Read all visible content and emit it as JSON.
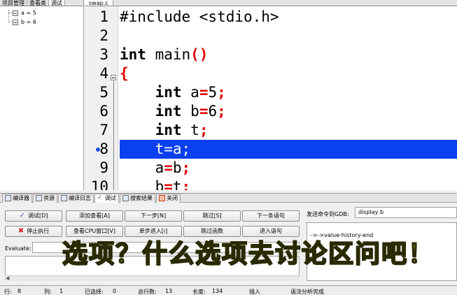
{
  "left_panel": {
    "tabs": [
      "项目管理",
      "查看类",
      "调试"
    ],
    "watches": [
      "a = 5",
      "b = 6"
    ]
  },
  "editor": {
    "file_tab": "swap.c",
    "line_numbers": [
      "1",
      "2",
      "3",
      "4",
      "5",
      "6",
      "7",
      "8",
      "9",
      "10"
    ],
    "current_line": 8
  },
  "bottom_tabs": [
    "编译器",
    "资源",
    "编译日志",
    "调试",
    "搜索结果",
    "关闭"
  ],
  "debug": {
    "buttons": {
      "debug": "调试[D]",
      "add_watch": "添加查看[A]",
      "next_step": "下一步[N]",
      "skip": "跳过[S]",
      "next_statement": "下一条语句",
      "stop": "停止执行",
      "view_cpu": "查看CPU窗口[V]",
      "step_into": "单步进入[i]",
      "skip_function": "跳过函数",
      "enter_statement": "进入语句"
    },
    "evaluate_label": "Evaluate:",
    "gdb_label": "发送命令到GDB:",
    "gdb_command": "display b",
    "gdb_output": "->->value-history-end"
  },
  "status_bar": {
    "row_label": "行:",
    "row": "8",
    "col_label": "列:",
    "col": "1",
    "selected_label": "已选择:",
    "selected": "0",
    "total_label": "总行数:",
    "total": "13",
    "length_label": "长度:",
    "length": "134",
    "mode": "插入",
    "parse_status": "语法分析完成"
  },
  "overlay_caption": "选项？什么选项去讨论区问吧！"
}
